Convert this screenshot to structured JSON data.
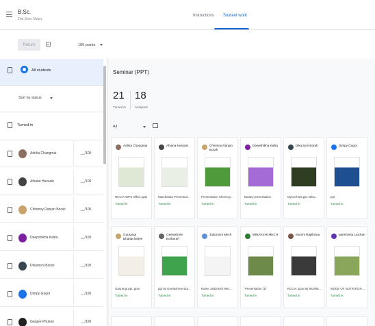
{
  "header": {
    "course_title": "B.Sc.",
    "course_subtitle": "2nd Sem. Major",
    "tabs": [
      {
        "label": "Instructions",
        "active": false
      },
      {
        "label": "Student work",
        "active": true
      }
    ]
  },
  "toolbar": {
    "return_label": "Return",
    "points_label": "100 points"
  },
  "sidebar": {
    "all_students_label": "All students",
    "sort_label": "Sort by status",
    "section_label": "Turned in",
    "students": [
      {
        "name": "Adrika Changmai",
        "grade": "__/100",
        "avatar_color": "#8d6e63"
      },
      {
        "name": "Afsana Hussain",
        "grade": "__/100",
        "avatar_color": "#424242"
      },
      {
        "name": "Chinmoy Ranjan Borah",
        "grade": "__/100",
        "avatar_color": "#c9a26a"
      },
      {
        "name": "Deepshikha Kalita",
        "grade": "__/100",
        "avatar_color": "#7b1fa2"
      },
      {
        "name": "Dikumoni Borah",
        "grade": "__/100",
        "avatar_color": "#37474f"
      },
      {
        "name": "Dimpy Gogoi",
        "grade": "__/100",
        "avatar_color": "#1a73e8"
      },
      {
        "name": "Gargee Phukon",
        "grade": "__/100",
        "avatar_color": "#212121"
      }
    ]
  },
  "main": {
    "title": "Seminar (PPT)",
    "turned_in_count": "21",
    "turned_in_label": "Turned in",
    "assigned_count": "18",
    "assigned_label": "Assigned",
    "filter_label": "All",
    "cards": [
      {
        "name": "Adrika Changmai",
        "file": "RCCIA-WPS Office.pptx",
        "status": "Turned in",
        "avatar_color": "#8d6e63",
        "thumb_color": "#dfe8d4"
      },
      {
        "name": "Afsana Hussain",
        "file": "Marchantia Presented...",
        "status": "Turned in",
        "avatar_color": "#424242",
        "thumb_color": "#e9efe4"
      },
      {
        "name": "Chinmoy Ranjan Borah",
        "file": "Presentation Chinmoy...",
        "status": "Turned in",
        "avatar_color": "#c9a26a",
        "thumb_color": "#4f9a3a"
      },
      {
        "name": "Deepshikha Kalita",
        "file": "Botany presentation",
        "status": "Turned in",
        "avatar_color": "#7b1fa2",
        "thumb_color": "#a46ad6"
      },
      {
        "name": "Dikumoni Borah",
        "file": "Mycorrhiza.ppt. Diku...",
        "status": "Turned in",
        "avatar_color": "#37474f",
        "thumb_color": "#2f3d22"
      },
      {
        "name": "Dimpy Gogoi",
        "file": "ppt",
        "status": "Turned in",
        "avatar_color": "#1a73e8",
        "thumb_color": "#1d4f91"
      },
      {
        "name": "Gaurangi Bhattacharjee",
        "file": "Gaurangi ppt .pptx",
        "status": "Turned in",
        "avatar_color": "#c9a26a",
        "thumb_color": "#f3efe6"
      },
      {
        "name": "Geetashree Borborah",
        "file": "ppt by Geetashree Bor...",
        "status": "Turned in",
        "avatar_color": "#616161",
        "thumb_color": "#3fa34d"
      },
      {
        "name": "Jadumoni Mech",
        "file": "Name Jadumoni Mec...",
        "status": "Turned in",
        "avatar_color": "#5c8fd6",
        "thumb_color": "#f4f4f4"
      },
      {
        "name": "MINAKSHI MECH",
        "file": "'Presentation (1)'",
        "status": "Turned in",
        "avatar_color": "#2e7d32",
        "thumb_color": "#6d8a4a"
      },
      {
        "name": "Munmi Rajkhowa",
        "file": "RCCIA .pptx By MUNM...",
        "status": "Turned in",
        "avatar_color": "#795548",
        "thumb_color": "#3a3a3a"
      },
      {
        "name": "parishmita Laichan",
        "file": "MODE OF NUTRITION ...",
        "status": "Turned in",
        "avatar_color": "#5e35b1",
        "thumb_color": "#8aa65a"
      }
    ]
  }
}
